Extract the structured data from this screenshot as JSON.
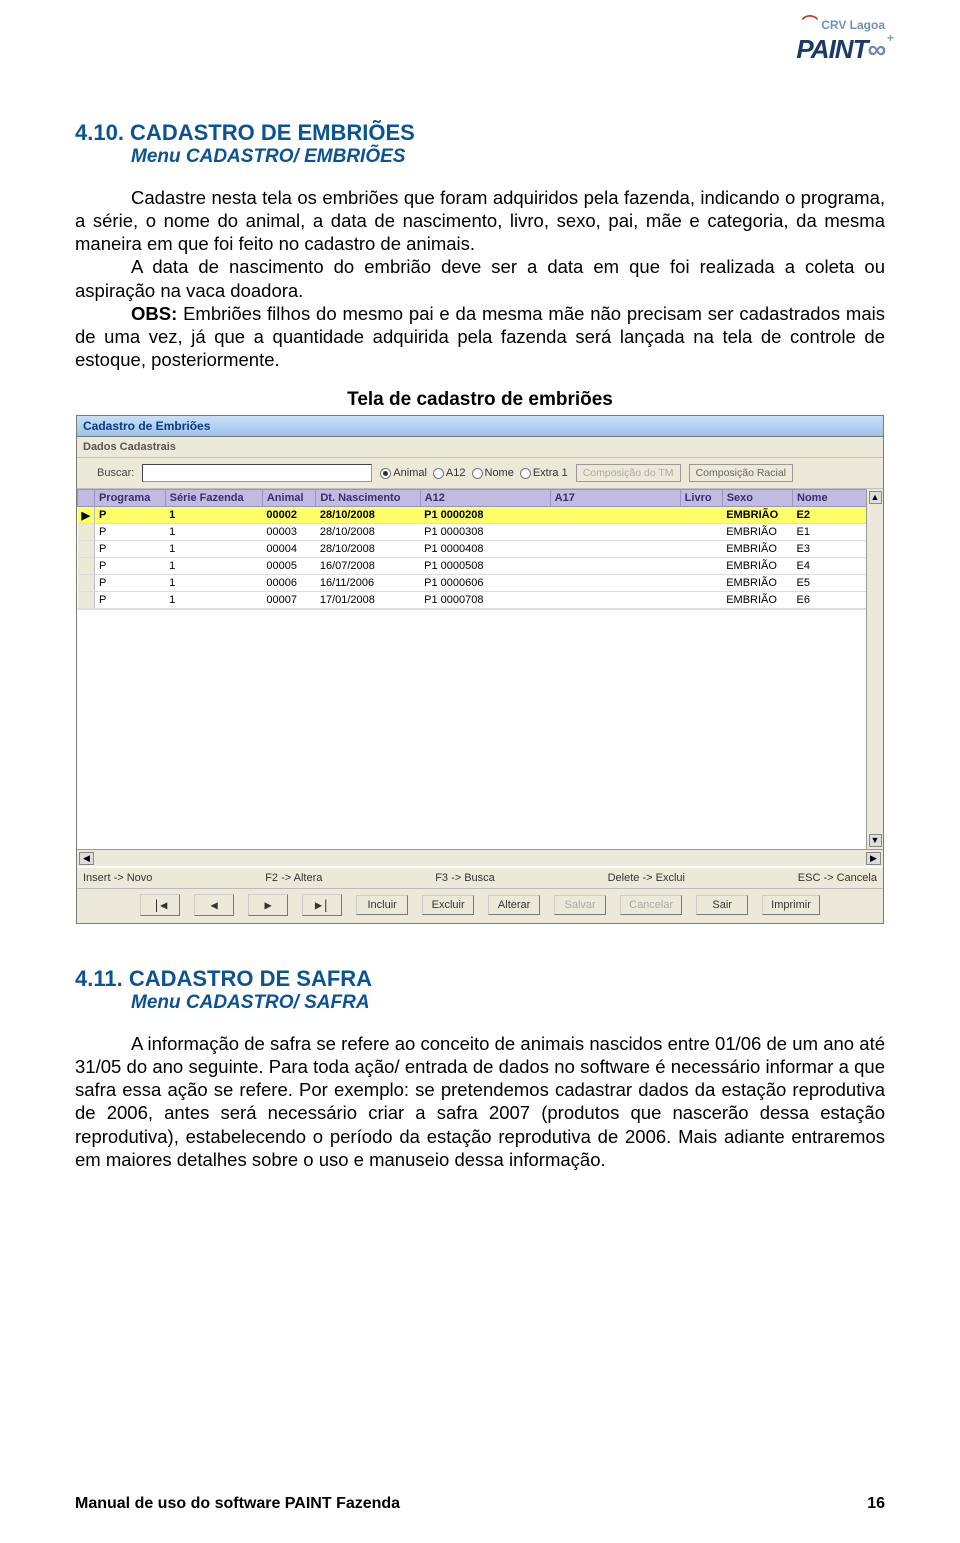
{
  "logo": {
    "crv": "CRV Lagoa",
    "paint": "PAINT",
    "inf": "∞",
    "plus": "+"
  },
  "section1": {
    "heading": "4.10. CADASTRO DE EMBRIÕES",
    "subheading": "Menu CADASTRO/ EMBRIÕES",
    "para1": "Cadastre nesta tela os embriões que foram adquiridos pela fazenda, indicando o programa, a série, o nome do animal, a data de nascimento, livro, sexo, pai, mãe e categoria, da mesma maneira em que foi feito no cadastro de animais.",
    "para2": "A data de nascimento do embrião deve ser a data em que foi realizada a coleta ou aspiração na vaca doadora.",
    "obs_label": "OBS:",
    "para3": " Embriões filhos do mesmo pai e da mesma mãe não precisam ser cadastrados mais de uma vez, já que a quantidade adquirida pela fazenda será lançada na tela de controle de estoque, posteriormente.",
    "caption": "Tela de cadastro de embriões"
  },
  "window": {
    "title": "Cadastro de Embriões",
    "subtitle": "Dados Cadastrais",
    "search_label": "Buscar:",
    "search_value": "",
    "radios": [
      "Animal",
      "A12",
      "Nome",
      "Extra 1"
    ],
    "radio_selected": 0,
    "btn_comp_tm": "Composição do TM",
    "btn_comp_racial": "Composição Racial",
    "headers": [
      "Programa",
      "Série Fazenda",
      "Animal",
      "Dt. Nascimento",
      "A12",
      "A17",
      "Livro",
      "Sexo",
      "Nome"
    ],
    "rows": [
      {
        "m": "▶",
        "p": "P",
        "s": "1",
        "a": "00002",
        "d": "28/10/2008",
        "a12": "P1  0000208",
        "a17": "",
        "l": "",
        "sx": "EMBRIÃO",
        "n": "E2",
        "sel": true
      },
      {
        "m": "",
        "p": "P",
        "s": "1",
        "a": "00003",
        "d": "28/10/2008",
        "a12": "P1  0000308",
        "a17": "",
        "l": "",
        "sx": "EMBRIÃO",
        "n": "E1",
        "sel": false
      },
      {
        "m": "",
        "p": "P",
        "s": "1",
        "a": "00004",
        "d": "28/10/2008",
        "a12": "P1  0000408",
        "a17": "",
        "l": "",
        "sx": "EMBRIÃO",
        "n": "E3",
        "sel": false
      },
      {
        "m": "",
        "p": "P",
        "s": "1",
        "a": "00005",
        "d": "16/07/2008",
        "a12": "P1  0000508",
        "a17": "",
        "l": "",
        "sx": "EMBRIÃO",
        "n": "E4",
        "sel": false
      },
      {
        "m": "",
        "p": "P",
        "s": "1",
        "a": "00006",
        "d": "16/11/2006",
        "a12": "P1  0000606",
        "a17": "",
        "l": "",
        "sx": "EMBRIÃO",
        "n": "E5",
        "sel": false
      },
      {
        "m": "",
        "p": "P",
        "s": "1",
        "a": "00007",
        "d": "17/01/2008",
        "a12": "P1  0000708",
        "a17": "",
        "l": "",
        "sx": "EMBRIÃO",
        "n": "E6",
        "sel": false
      }
    ],
    "status": {
      "novo": "Insert -> Novo",
      "altera": "F2 -> Altera",
      "busca": "F3 -> Busca",
      "exclui": "Delete -> Exclui",
      "cancela": "ESC -> Cancela"
    },
    "nav_arrows": [
      "|◀",
      "◀",
      "▶",
      "▶|"
    ],
    "nav_buttons": [
      {
        "label": "Incluir",
        "disabled": false
      },
      {
        "label": "Excluir",
        "disabled": false
      },
      {
        "label": "Alterar",
        "disabled": false
      },
      {
        "label": "Salvar",
        "disabled": true
      },
      {
        "label": "Cancelar",
        "disabled": true
      },
      {
        "label": "Sair",
        "disabled": false
      },
      {
        "label": "Imprimir",
        "disabled": false
      }
    ]
  },
  "section2": {
    "heading": "4.11. CADASTRO DE SAFRA",
    "subheading": "Menu CADASTRO/ SAFRA",
    "para": "A informação de safra se refere ao conceito de animais nascidos entre 01/06 de um ano até 31/05 do ano seguinte. Para toda ação/ entrada de dados no software é necessário informar a que safra essa ação se refere. Por exemplo: se pretendemos cadastrar dados da estação reprodutiva de 2006, antes será necessário criar a safra 2007 (produtos que nascerão dessa estação reprodutiva), estabelecendo o período da estação reprodutiva de 2006. Mais adiante entraremos em maiores detalhes sobre o uso e manuseio dessa informação."
  },
  "footer": {
    "left": "Manual de uso do software PAINT Fazenda",
    "right": "16"
  }
}
